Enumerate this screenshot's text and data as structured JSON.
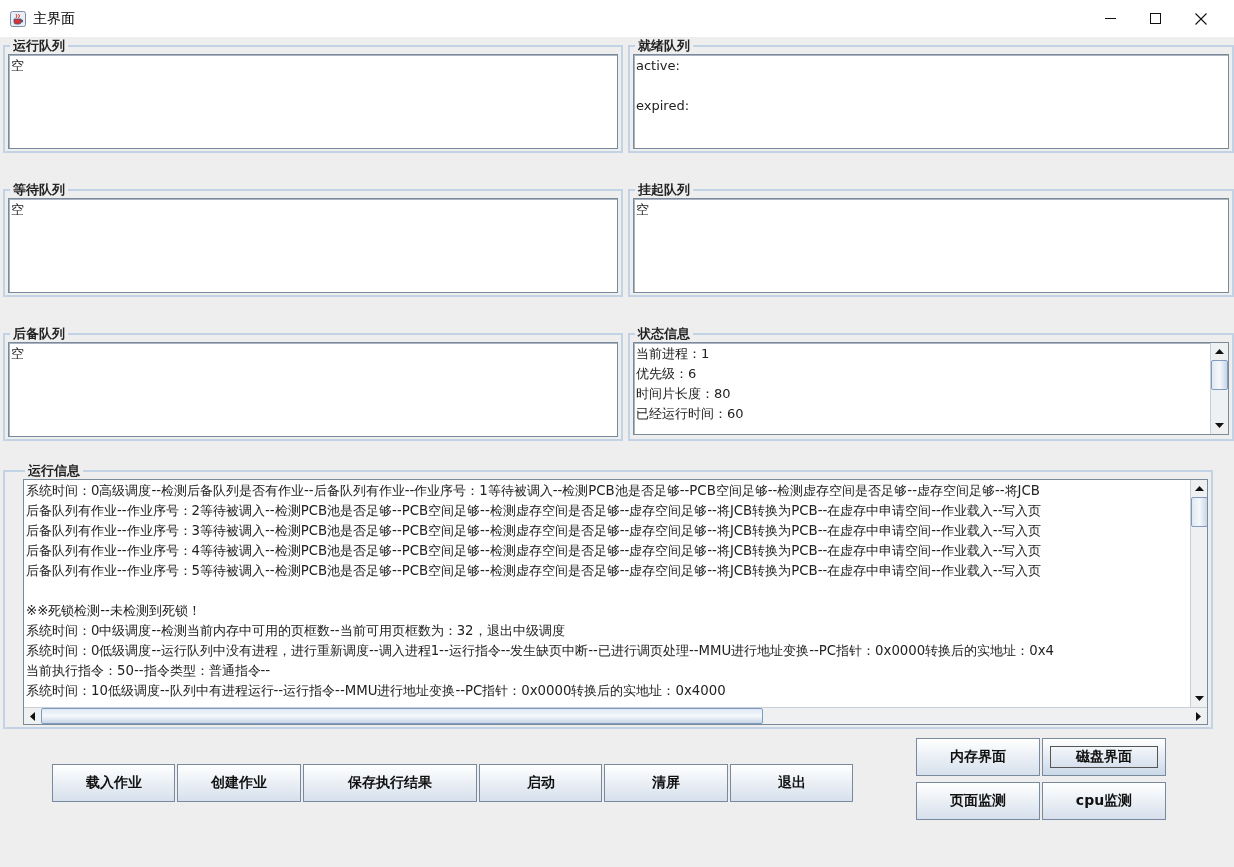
{
  "window": {
    "title": "主界面"
  },
  "panels": [
    {
      "title": "运行队列",
      "text": "空",
      "scrollable": false
    },
    {
      "title": "就绪队列",
      "text": "active:\n\nexpired:",
      "scrollable": false
    },
    {
      "title": "等待队列",
      "text": "空",
      "scrollable": false
    },
    {
      "title": "挂起队列",
      "text": "空",
      "scrollable": false
    },
    {
      "title": "后备队列",
      "text": "空",
      "scrollable": false
    },
    {
      "title": "状态信息",
      "text": "当前进程：1\n优先级：6\n时间片长度：80\n已经运行时间：60",
      "scrollable": true
    }
  ],
  "log": {
    "title": "运行信息",
    "blocks": [
      {
        "lines": [
          "系统时间：0高级调度--检测后备队列是否有作业--后备队列有作业--作业序号：1等待被调入--检测PCB池是否足够--PCB空间足够--检测虚存空间是否足够--虚存空间足够--将JCB",
          "后备队列有作业--作业序号：2等待被调入--检测PCB池是否足够--PCB空间足够--检测虚存空间是否足够--虚存空间足够--将JCB转换为PCB--在虚存中申请空间--作业载入--写入页",
          "后备队列有作业--作业序号：3等待被调入--检测PCB池是否足够--PCB空间足够--检测虚存空间是否足够--虚存空间足够--将JCB转换为PCB--在虚存中申请空间--作业载入--写入页",
          "后备队列有作业--作业序号：4等待被调入--检测PCB池是否足够--PCB空间足够--检测虚存空间是否足够--虚存空间足够--将JCB转换为PCB--在虚存中申请空间--作业载入--写入页",
          "后备队列有作业--作业序号：5等待被调入--检测PCB池是否足够--PCB空间足够--检测虚存空间是否足够--虚存空间足够--将JCB转换为PCB--在虚存中申请空间--作业载入--写入页"
        ]
      },
      {
        "lines": [
          "※※死锁检测--未检测到死锁！",
          "系统时间：0中级调度--检测当前内存中可用的页框数--当前可用页框数为：32，退出中级调度",
          "系统时间：0低级调度--运行队列中没有进程，进行重新调度--调入进程1--运行指令--发生缺页中断--已进行调页处理--MMU进行地址变换--PC指针：0x0000转换后的实地址：0x4",
          "当前执行指令：50--指令类型：普通指令--",
          "系统时间：10低级调度--队列中有进程运行--运行指令--MMU进行地址变换--PC指针：0x0000转换后的实地址：0x4000"
        ]
      }
    ]
  },
  "buttons": [
    "载入作业",
    "创建作业",
    "保存执行结果",
    "启动",
    "清屏",
    "退出"
  ],
  "side_buttons": [
    {
      "label": "内存界面",
      "focused": false
    },
    {
      "label": "磁盘界面",
      "focused": true
    },
    {
      "label": "页面监测",
      "focused": false
    },
    {
      "label": "cpu监测",
      "focused": false
    }
  ]
}
